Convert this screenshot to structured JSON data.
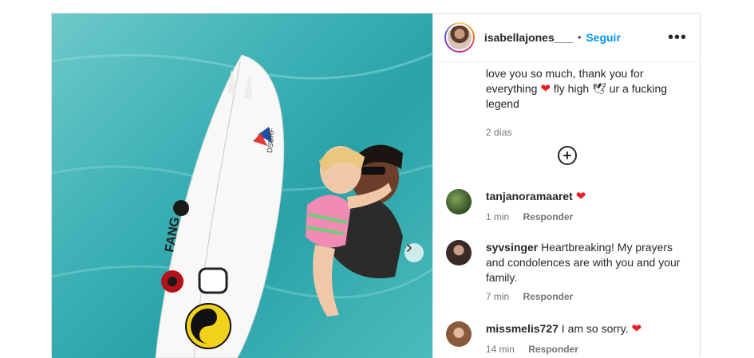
{
  "post": {
    "username": "isabellajones___",
    "separator": "•",
    "follow_label": "Seguir",
    "more_label": "•••",
    "caption": {
      "text_part1": "love you so much, thank you for everything",
      "text_part2": "fly high",
      "text_part3": "ur a fucking legend",
      "time": "2 días"
    },
    "load_more_label": "+",
    "comments": [
      {
        "user": "tanjanoramaaret",
        "text": "",
        "time": "1 min",
        "reply": "Responder",
        "has_heart": true
      },
      {
        "user": "syvsinger",
        "text": "Heartbreaking! My prayers and condolences are with you and your family.",
        "time": "7 min",
        "reply": "Responder",
        "has_heart": false
      },
      {
        "user": "missmelis727",
        "text": "I am so sorry.",
        "time": "14 min",
        "reply": "Responder",
        "has_heart": true
      }
    ],
    "icons": {
      "heart": "❤",
      "dove": "🕊",
      "next": "›"
    },
    "colors": {
      "follow": "#0095f6",
      "heart": "#ed1c24",
      "secondary_text": "#737373"
    }
  }
}
